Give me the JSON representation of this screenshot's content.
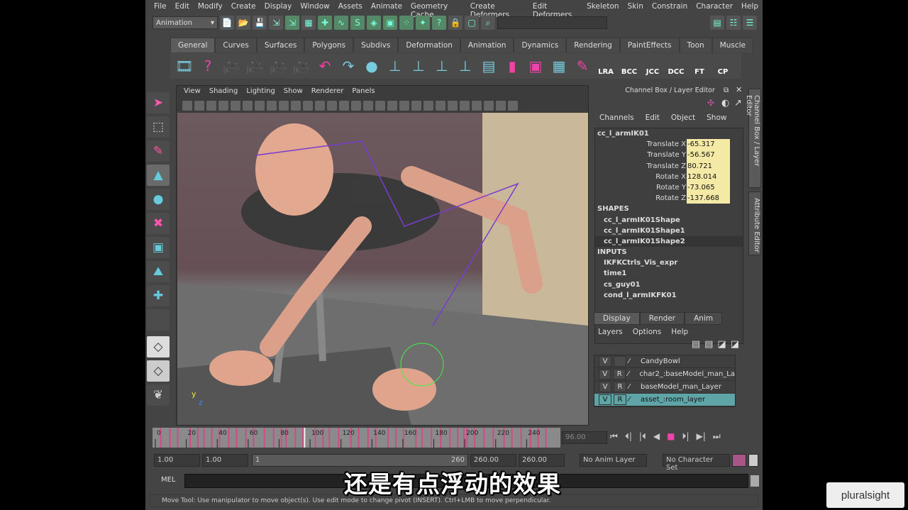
{
  "menu": [
    "File",
    "Edit",
    "Modify",
    "Create",
    "Display",
    "Window",
    "Assets",
    "Animate",
    "Geometry Cache",
    "Create Deformers",
    "Edit Deformers",
    "Skeleton",
    "Skin",
    "Constrain",
    "Character",
    "Help"
  ],
  "status": {
    "mode": "Animation"
  },
  "shelf": {
    "tabs": [
      "General",
      "Curves",
      "Surfaces",
      "Polygons",
      "Subdivs",
      "Deformation",
      "Animation",
      "Dynamics",
      "Rendering",
      "PaintEffects",
      "Toon",
      "Muscle"
    ],
    "active": "General",
    "icons": [
      "render-view-icon",
      "help-icon",
      "camera-icon",
      "camera-icon",
      "camera-icon",
      "camera-icon",
      "ik-handle-icon",
      "undo-icon",
      "sphere-trash-icon",
      "joint-icon",
      "joint-icon",
      "joint-icon",
      "joint-icon",
      "outliner-icon",
      "select-icon",
      "cube-select-icon",
      "cubes-icon",
      "paint-icon"
    ],
    "labels": [
      "LRA",
      "BCC",
      "JCC",
      "DCC",
      "FT",
      "CP"
    ]
  },
  "viewport": {
    "menu": [
      "View",
      "Shading",
      "Lighting",
      "Show",
      "Renderer",
      "Panels"
    ]
  },
  "channel_box": {
    "title": "Channel Box / Layer Editor",
    "menu": [
      "Channels",
      "Edit",
      "Object",
      "Show"
    ],
    "object": "cc_l_armIK01",
    "attributes": [
      {
        "name": "Translate X",
        "value": "-65.317"
      },
      {
        "name": "Translate Y",
        "value": "-56.567"
      },
      {
        "name": "Translate Z",
        "value": "80.721"
      },
      {
        "name": "Rotate X",
        "value": "128.014"
      },
      {
        "name": "Rotate Y",
        "value": "-73.065"
      },
      {
        "name": "Rotate Z",
        "value": "-137.668"
      }
    ],
    "shapes_label": "SHAPES",
    "shapes": [
      "cc_l_armIK01Shape",
      "cc_l_armIK01Shape1",
      "cc_l_armIK01Shape2"
    ],
    "inputs_label": "INPUTS",
    "inputs": [
      "IKFKCtrls_Vis_expr",
      "time1",
      "cs_guy01",
      "cond_l_armIKFK01"
    ]
  },
  "side_tabs": [
    "Channel Box / Layer Editor",
    "Attribute Editor"
  ],
  "layer_editor": {
    "tabs": [
      "Display",
      "Render",
      "Anim"
    ],
    "menu": [
      "Layers",
      "Options",
      "Help"
    ],
    "layers": [
      {
        "v": "V",
        "r": "",
        "name": "CandyBowl"
      },
      {
        "v": "V",
        "r": "R",
        "name": "char2_:baseModel_man_La"
      },
      {
        "v": "V",
        "r": "R",
        "name": "baseModel_man_Layer"
      },
      {
        "v": "V",
        "r": "R",
        "name": "asset_:room_layer",
        "selected": true
      }
    ]
  },
  "timeline": {
    "ticks": [
      0,
      20,
      40,
      60,
      80,
      100,
      120,
      140,
      160,
      180,
      200,
      220,
      240
    ],
    "range": [
      0,
      260
    ],
    "current_frame": "96.00",
    "current": 96,
    "keys": [
      3,
      9,
      14,
      22,
      27,
      31,
      36,
      41,
      47,
      52,
      58,
      63,
      70,
      76,
      81,
      84,
      90,
      95,
      103,
      108,
      112,
      118,
      126,
      131,
      137,
      142,
      150,
      155,
      160,
      168,
      172,
      178,
      184,
      190,
      195,
      199,
      201,
      206,
      212,
      218,
      225,
      230,
      236,
      242,
      247,
      252
    ]
  },
  "range": {
    "start": "1.00",
    "min": "1.00",
    "slider_start": "1",
    "slider_end": "260",
    "end": "260.00",
    "max": "260.00",
    "anim_layer": "No Anim Layer",
    "char_set": "No Character Set"
  },
  "command": {
    "label": "MEL"
  },
  "help_line": "Move Tool: Use manipulator to move object(s). Use edit mode to change pivot (INSERT).  Ctrl+LMB to move perpendicular.",
  "subtitle": "还是有点浮动的效果",
  "logo": "pluralsight"
}
